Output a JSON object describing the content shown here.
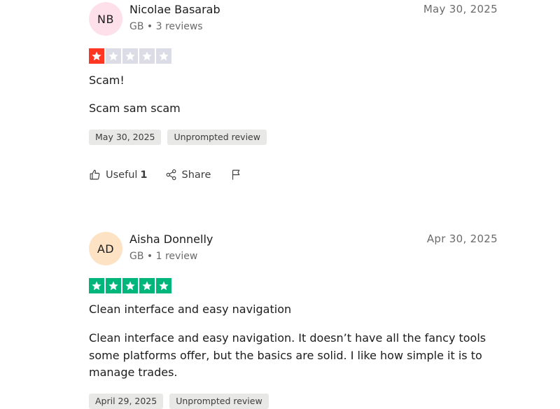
{
  "reviews": [
    {
      "initials": "NB",
      "avatar_color": "#fde0ea",
      "name": "Nicolae Basarab",
      "country": "GB",
      "review_count": "3 reviews",
      "date": "May 30, 2025",
      "rating": 1,
      "rating_color": "#ff3722",
      "title": "Scam!",
      "body": "Scam sam scam",
      "experience_date": "May 30, 2025",
      "label": "Unprompted review",
      "useful_label": "Useful",
      "useful_count": "1",
      "share_label": "Share"
    },
    {
      "initials": "AD",
      "avatar_color": "#fde3c4",
      "name": "Aisha Donnelly",
      "country": "GB",
      "review_count": "1 review",
      "date": "Apr 30, 2025",
      "rating": 5,
      "rating_color": "#00b67a",
      "title": "Clean interface and easy navigation",
      "body": "Clean interface and easy navigation. It doesn’t have all the fancy tools some platforms offer, but the basics are solid. I like how simple it is to manage trades.",
      "experience_date": "April 29, 2025",
      "label": "Unprompted review"
    }
  ],
  "empty_star_color": "#dcdce6",
  "icons": [
    "thumbs-up-icon",
    "share-icon",
    "flag-icon",
    "star-icon"
  ]
}
